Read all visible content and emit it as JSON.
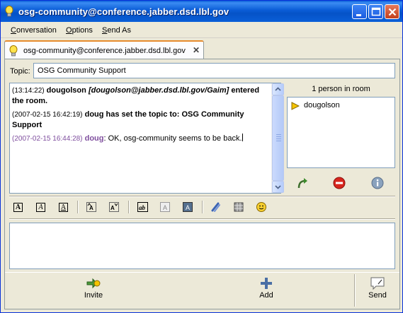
{
  "window": {
    "title": "osg-community@conference.jabber.dsd.lbl.gov"
  },
  "menu": {
    "items": [
      {
        "label": "Conversation",
        "mnemonic": "C",
        "rest": "onversation"
      },
      {
        "label": "Options",
        "mnemonic": "O",
        "rest": "ptions"
      },
      {
        "label": "Send As",
        "mnemonic": "S",
        "rest": "end As"
      }
    ]
  },
  "tab": {
    "label": "osg-community@conference.jabber.dsd.lbl.gov",
    "close": "✕"
  },
  "topic": {
    "label": "Topic:",
    "value": "OSG Community Support"
  },
  "chat": {
    "entries": [
      {
        "timestamp": "(13:14:22)",
        "name": "dougolson",
        "jid": "[dougolson@jabber.dsd.lbl.gov/Gaim]",
        "text": "entered the room."
      },
      {
        "timestamp": "(2007-02-15 16:42:19)",
        "text": "doug has set the topic to: OSG Community Support"
      },
      {
        "timestamp": "(2007-02-15 16:44:28)",
        "name": "doug",
        "text": ": OK, osg-community seems to be back."
      }
    ]
  },
  "people": {
    "count_label": "1 person in room",
    "list": [
      "dougolson"
    ]
  },
  "actions": {
    "invite": "Invite",
    "add": "Add",
    "send": "Send"
  },
  "colors": {
    "titlebar": "#0a5cd6",
    "tab_accent": "#e68b2c",
    "own_name": "#7f4e9e"
  }
}
